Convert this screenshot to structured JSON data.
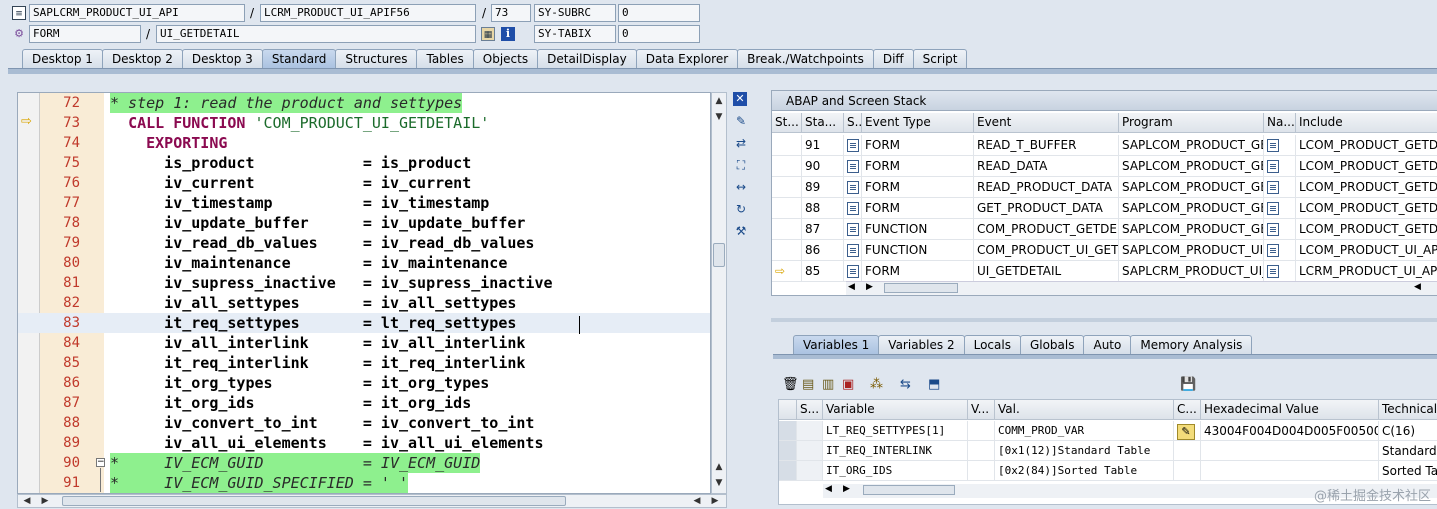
{
  "header": {
    "row1": {
      "program": "SAPLCRM_PRODUCT_UI_API",
      "include": "LCRM_PRODUCT_UI_APIF56",
      "line": "73",
      "var1_name": "SY-SUBRC",
      "var1_value": "0"
    },
    "row2": {
      "event_type": "FORM",
      "event": "UI_GETDETAIL",
      "var2_name": "SY-TABIX",
      "var2_value": "0"
    },
    "sep": "/"
  },
  "tabs": [
    "Desktop 1",
    "Desktop 2",
    "Desktop 3",
    "Standard",
    "Structures",
    "Tables",
    "Objects",
    "DetailDisplay",
    "Data Explorer",
    "Break./Watchpoints",
    "Diff",
    "Script"
  ],
  "active_tab": "Standard",
  "code": [
    {
      "n": "72",
      "t": "* step 1: read the product and settypes",
      "k": "cmt"
    },
    {
      "n": "73",
      "pre": "  ",
      "kw": "CALL FUNCTION",
      "post": " ",
      "str": "'COM_PRODUCT_UI_GETDETAIL'",
      "k": "call"
    },
    {
      "n": "74",
      "pre": "    ",
      "kw": "EXPORTING",
      "k": "kwline"
    },
    {
      "n": "75",
      "t": "      is_product            = is_product",
      "k": "b"
    },
    {
      "n": "76",
      "t": "      iv_current            = iv_current",
      "k": "b"
    },
    {
      "n": "77",
      "t": "      iv_timestamp          = iv_timestamp",
      "k": "b"
    },
    {
      "n": "78",
      "t": "      iv_update_buffer      = iv_update_buffer",
      "k": "b"
    },
    {
      "n": "79",
      "t": "      iv_read_db_values     = iv_read_db_values",
      "k": "b"
    },
    {
      "n": "80",
      "t": "      iv_maintenance        = iv_maintenance",
      "k": "b"
    },
    {
      "n": "81",
      "t": "      iv_supress_inactive   = iv_supress_inactive",
      "k": "b"
    },
    {
      "n": "82",
      "t": "      iv_all_settypes       = iv_all_settypes",
      "k": "b"
    },
    {
      "n": "83",
      "t": "      it_req_settypes       = lt_req_settypes",
      "k": "bh"
    },
    {
      "n": "84",
      "t": "      iv_all_interlink      = iv_all_interlink",
      "k": "b"
    },
    {
      "n": "85",
      "t": "      it_req_interlink      = it_req_interlink",
      "k": "b"
    },
    {
      "n": "86",
      "t": "      it_org_types          = it_org_types",
      "k": "b"
    },
    {
      "n": "87",
      "t": "      it_org_ids            = it_org_ids",
      "k": "b"
    },
    {
      "n": "88",
      "t": "      iv_convert_to_int     = iv_convert_to_int",
      "k": "b"
    },
    {
      "n": "89",
      "t": "      iv_all_ui_elements    = iv_all_ui_elements",
      "k": "b"
    },
    {
      "n": "90",
      "t": "*     IV_ECM_GUID           = IV_ECM_GUID",
      "k": "cmt"
    },
    {
      "n": "91",
      "t": "*     IV_ECM_GUID_SPECIFIED = ' '",
      "k": "cmt"
    }
  ],
  "stack": {
    "title": "ABAP and Screen Stack",
    "headers": [
      "St...",
      "Sta...",
      "S...",
      "Event Type",
      "Event",
      "Program",
      "Na...",
      "Include"
    ],
    "rows": [
      {
        "sta": "91",
        "type": "FORM",
        "event": "READ_T_BUFFER",
        "program": "SAPLCOM_PRODUCT_GE...",
        "include": "LCOM_PRODUCT_GETDE..."
      },
      {
        "sta": "90",
        "type": "FORM",
        "event": "READ_DATA",
        "program": "SAPLCOM_PRODUCT_GE...",
        "include": "LCOM_PRODUCT_GETDE..."
      },
      {
        "sta": "89",
        "type": "FORM",
        "event": "READ_PRODUCT_DATA",
        "program": "SAPLCOM_PRODUCT_GE...",
        "include": "LCOM_PRODUCT_GETDE..."
      },
      {
        "sta": "88",
        "type": "FORM",
        "event": "GET_PRODUCT_DATA",
        "program": "SAPLCOM_PRODUCT_GE...",
        "include": "LCOM_PRODUCT_GETDE..."
      },
      {
        "sta": "87",
        "type": "FUNCTION",
        "event": "COM_PRODUCT_GETDE...",
        "program": "SAPLCOM_PRODUCT_GE...",
        "include": "LCOM_PRODUCT_GETDE..."
      },
      {
        "sta": "86",
        "type": "FUNCTION",
        "event": "COM_PRODUCT_UI_GET...",
        "program": "SAPLCOM_PRODUCT_UI...",
        "include": "LCOM_PRODUCT_UI_API..."
      },
      {
        "sta": "85",
        "type": "FORM",
        "event": "UI_GETDETAIL",
        "program": "SAPLCRM_PRODUCT_UI_...",
        "include": "LCRM_PRODUCT_UI_API..."
      }
    ]
  },
  "vartabs": [
    "Variables 1",
    "Variables 2",
    "Locals",
    "Globals",
    "Auto",
    "Memory Analysis"
  ],
  "active_vartab": "Variables 1",
  "vars": {
    "headers": [
      "S...",
      "Variable",
      "V...",
      "Val.",
      "C...",
      "Hexadecimal Value",
      "Technical"
    ],
    "rows": [
      {
        "name": "LT_REQ_SETTYPES[1]",
        "val": "COMM_PROD_VAR",
        "hex": "43004F004D004D005F005000...",
        "tech": "C(16)"
      },
      {
        "name": "IT_REQ_INTERLINK",
        "val": "[0x1(12)]Standard Table",
        "hex": "",
        "tech": "Standard T"
      },
      {
        "name": "IT_ORG_IDS",
        "val": "[0x2(84)]Sorted Table",
        "hex": "",
        "tech": "Sorted Tal"
      }
    ]
  },
  "watermark": "@稀土掘金技术社区"
}
